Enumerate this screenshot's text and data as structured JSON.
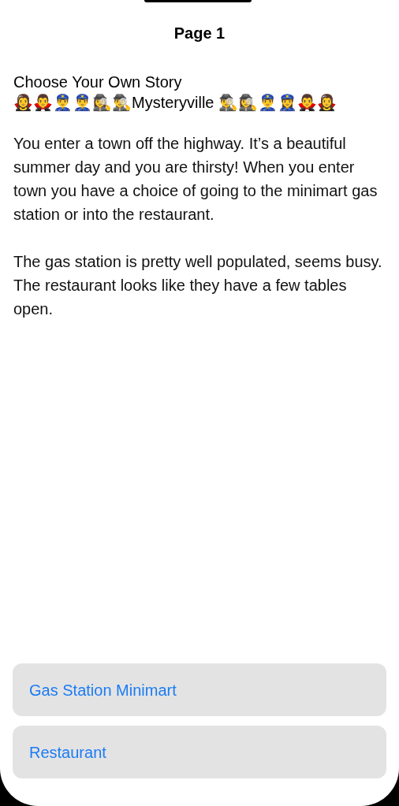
{
  "title": "Page 1",
  "story_heading": "Choose Your Own Story\n🧛‍♀️🧛‍♂️👮‍♂️👮‍♂️🕵️‍♀️🕵️‍♂️Mysteryville 🕵️‍♂️🕵️‍♀️👮‍♂️👮‍♀️🧛‍♂️🧛‍♀️",
  "paragraphs": [
    "You enter a town off the highway. It’s a beautiful summer day and you are thirsty! When you enter town you have a choice of going to the minimart gas station or into the restaurant.",
    "The gas station is pretty well populated, seems busy. The restaurant looks like they have a few tables open."
  ],
  "choices": [
    "Gas Station Minimart",
    "Restaurant"
  ]
}
